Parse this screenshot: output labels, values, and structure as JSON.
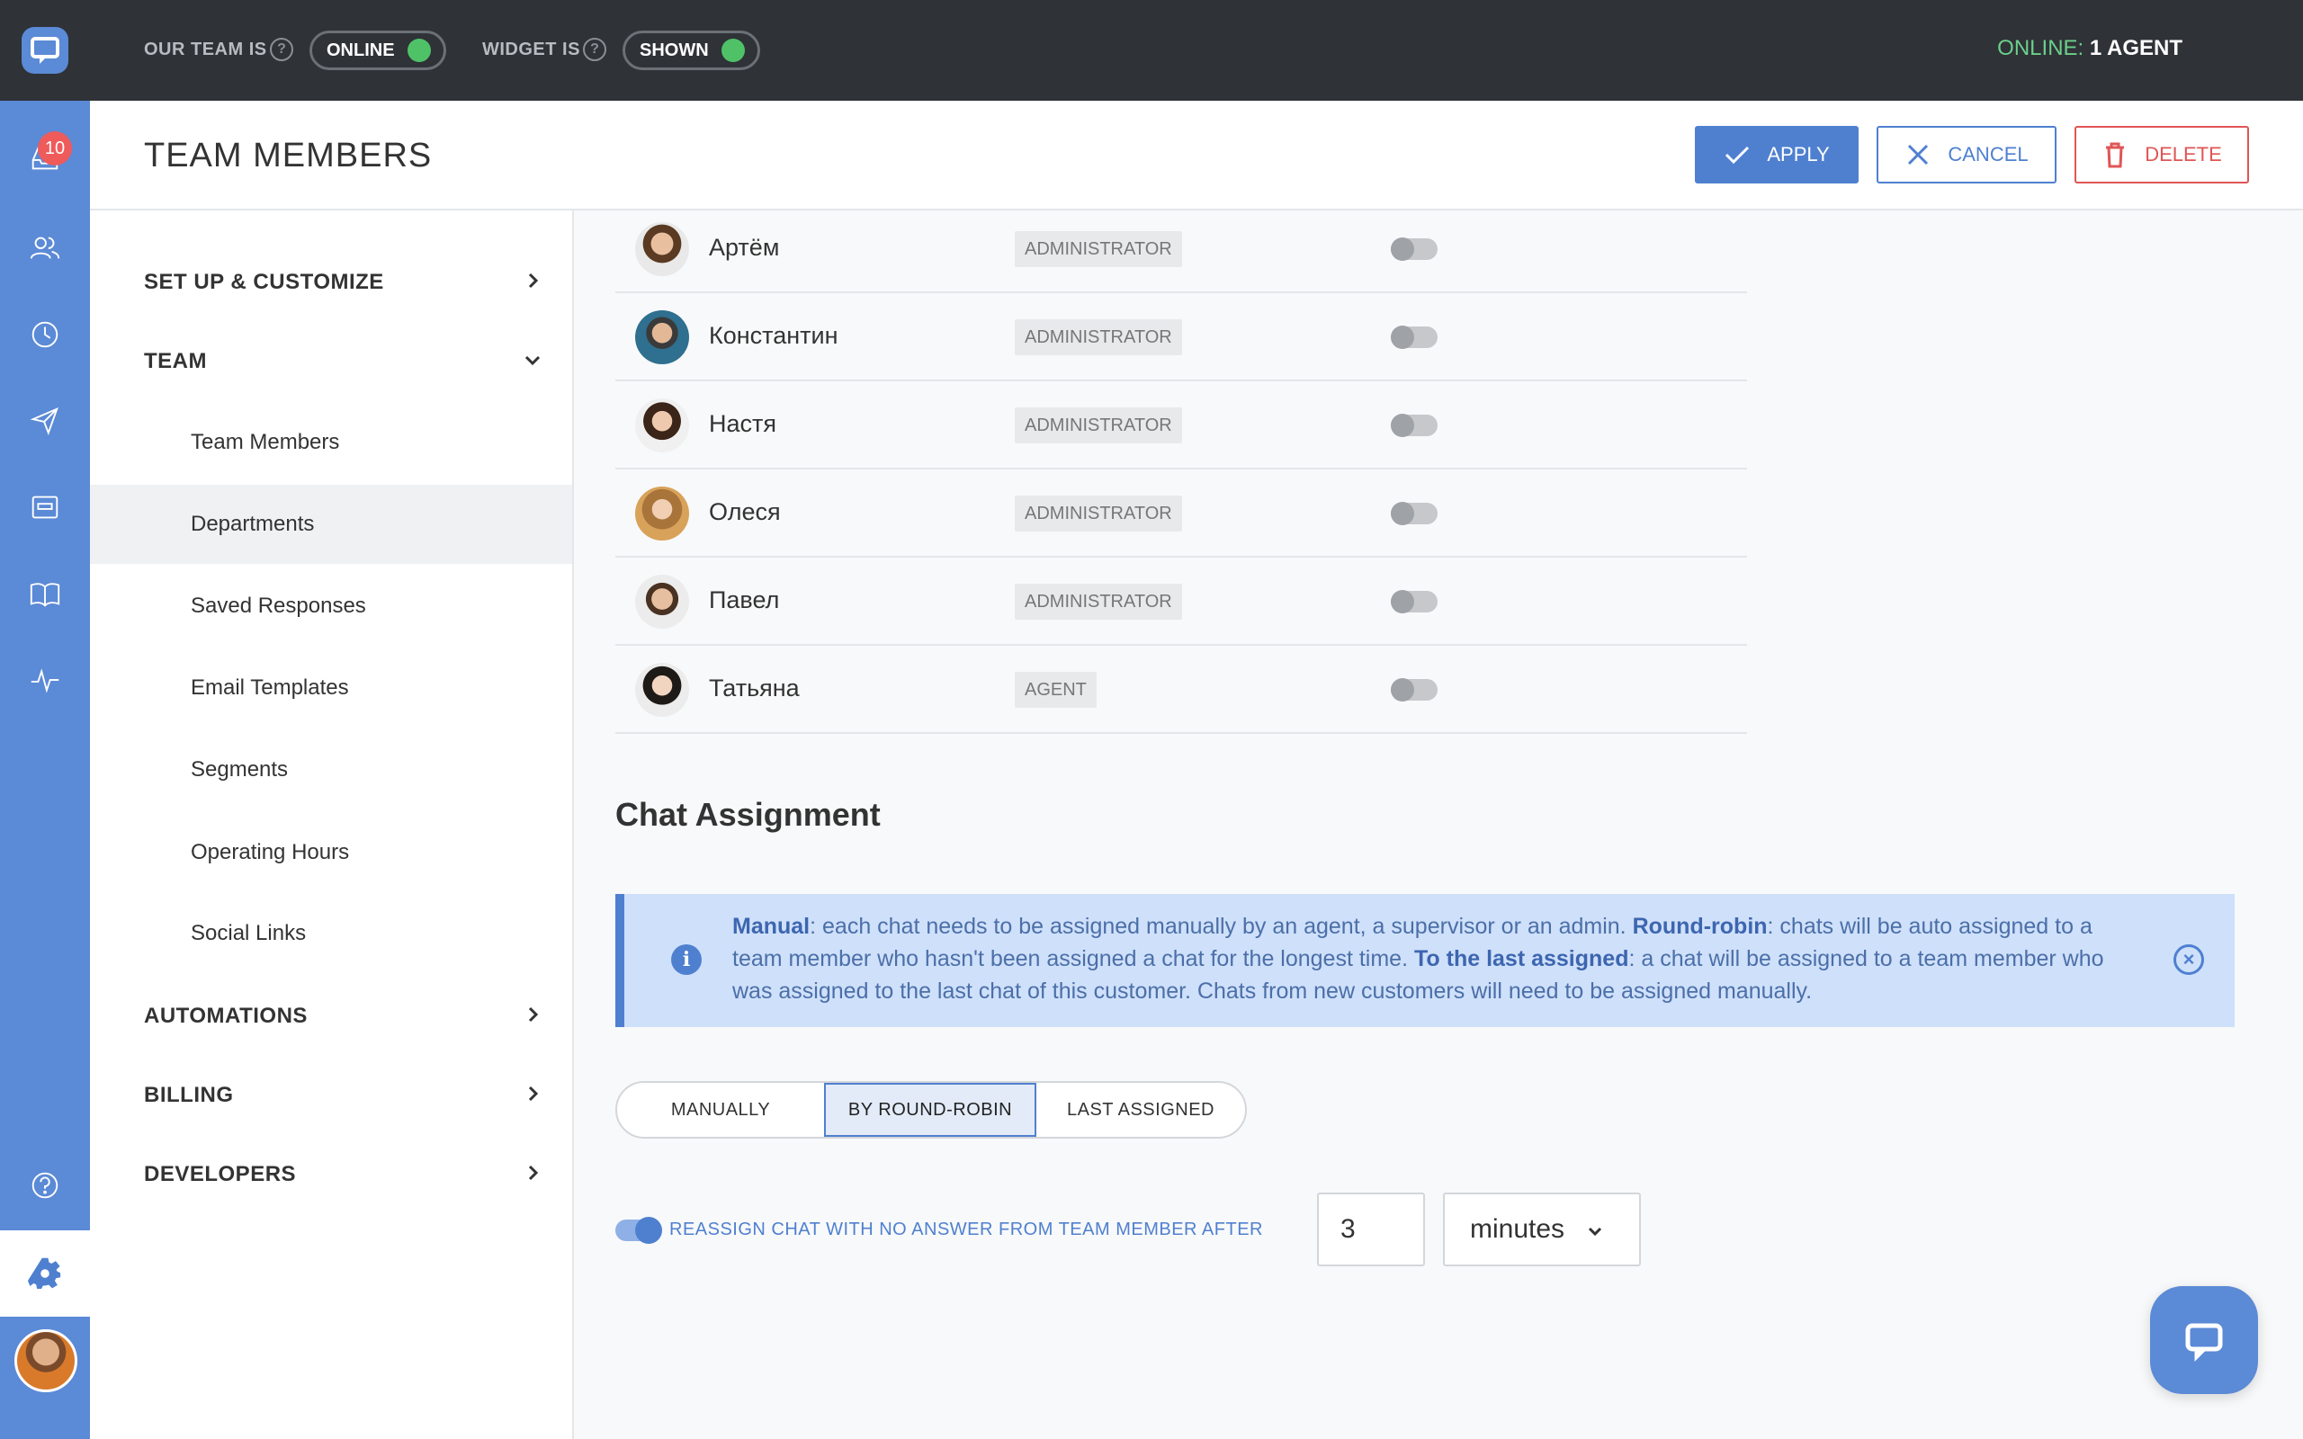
{
  "topbar": {
    "team_label": "OUR TEAM IS",
    "team_status": "ONLINE",
    "widget_label": "WIDGET IS",
    "widget_status": "SHOWN",
    "online_prefix": "ONLINE:",
    "online_count": "1 AGENT"
  },
  "rail": {
    "badge_count": "10",
    "items": [
      "inbox-icon",
      "contacts-icon",
      "clock-icon",
      "send-icon",
      "widget-icon",
      "book-icon",
      "pulse-icon",
      "help-icon",
      "gear-icon"
    ]
  },
  "header": {
    "title": "TEAM MEMBERS",
    "apply": "APPLY",
    "cancel": "CANCEL",
    "delete": "DELETE"
  },
  "nav": {
    "setup": "SET UP & CUSTOMIZE",
    "team": "TEAM",
    "team_items": [
      "Team Members",
      "Departments",
      "Saved Responses",
      "Email Templates",
      "Segments",
      "Operating Hours",
      "Social Links"
    ],
    "active_item": "Departments",
    "automations": "AUTOMATIONS",
    "billing": "BILLING",
    "developers": "DEVELOPERS"
  },
  "members": [
    {
      "name": "Артём",
      "role": "ADMINISTRATOR"
    },
    {
      "name": "Константин",
      "role": "ADMINISTRATOR"
    },
    {
      "name": "Настя",
      "role": "ADMINISTRATOR"
    },
    {
      "name": "Олеся",
      "role": "ADMINISTRATOR"
    },
    {
      "name": "Павел",
      "role": "ADMINISTRATOR"
    },
    {
      "name": "Татьяна",
      "role": "AGENT"
    }
  ],
  "assignment": {
    "title": "Chat Assignment",
    "info": {
      "manual_label": "Manual",
      "manual_text": ": each chat needs to be assigned manually by an agent, a supervisor or an admin. ",
      "rr_label": "Round-robin",
      "rr_text": ": chats will be auto assigned to a team member who hasn't been assigned a chat for the longest time. ",
      "last_label": "To the last assigned",
      "last_text": ": a chat will be assigned to a team member who was assigned to the last chat of this customer. Chats from new customers will need to be assigned manually."
    },
    "modes": [
      "MANUALLY",
      "BY ROUND-ROBIN",
      "LAST ASSIGNED"
    ],
    "active_mode": "BY ROUND-ROBIN",
    "reassign_label": "REASSIGN CHAT WITH NO ANSWER FROM TEAM MEMBER AFTER",
    "reassign_enabled": true,
    "reassign_value": "3",
    "reassign_unit": "minutes"
  },
  "colors": {
    "accent": "#4f80d0",
    "danger": "#e05555",
    "online": "#4fc268"
  }
}
